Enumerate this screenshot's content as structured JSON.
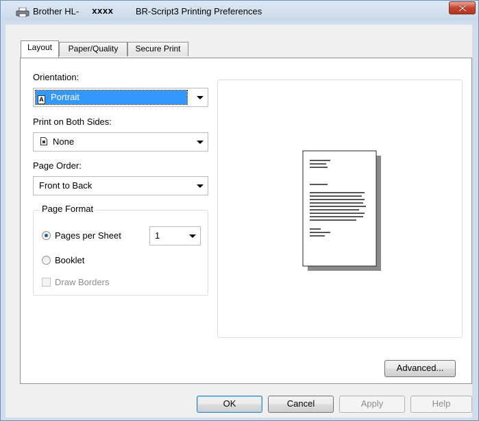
{
  "window": {
    "title_prefix": "Brother HL-",
    "title_model": "xxxx",
    "title_app": "BR-Script3 Printing Preferences"
  },
  "tabs": [
    {
      "label": "Layout",
      "active": true
    },
    {
      "label": "Paper/Quality",
      "active": false
    },
    {
      "label": "Secure Print",
      "active": false
    }
  ],
  "layout": {
    "orientation_label": "Orientation:",
    "orientation_value": "Portrait",
    "orientation_icon": "A",
    "print_both_sides_label": "Print on Both Sides:",
    "print_both_sides_value": "None",
    "page_order_label": "Page Order:",
    "page_order_value": "Front to Back",
    "page_format_label": "Page Format",
    "pages_per_sheet_label": "Pages per Sheet",
    "pages_per_sheet_value": "1",
    "booklet_label": "Booklet",
    "draw_borders_label": "Draw Borders",
    "advanced_button": "Advanced..."
  },
  "buttons": {
    "ok": "OK",
    "cancel": "Cancel",
    "apply": "Apply",
    "help": "Help"
  },
  "colors": {
    "selection": "#3399ff",
    "close_button": "#c7432e"
  }
}
